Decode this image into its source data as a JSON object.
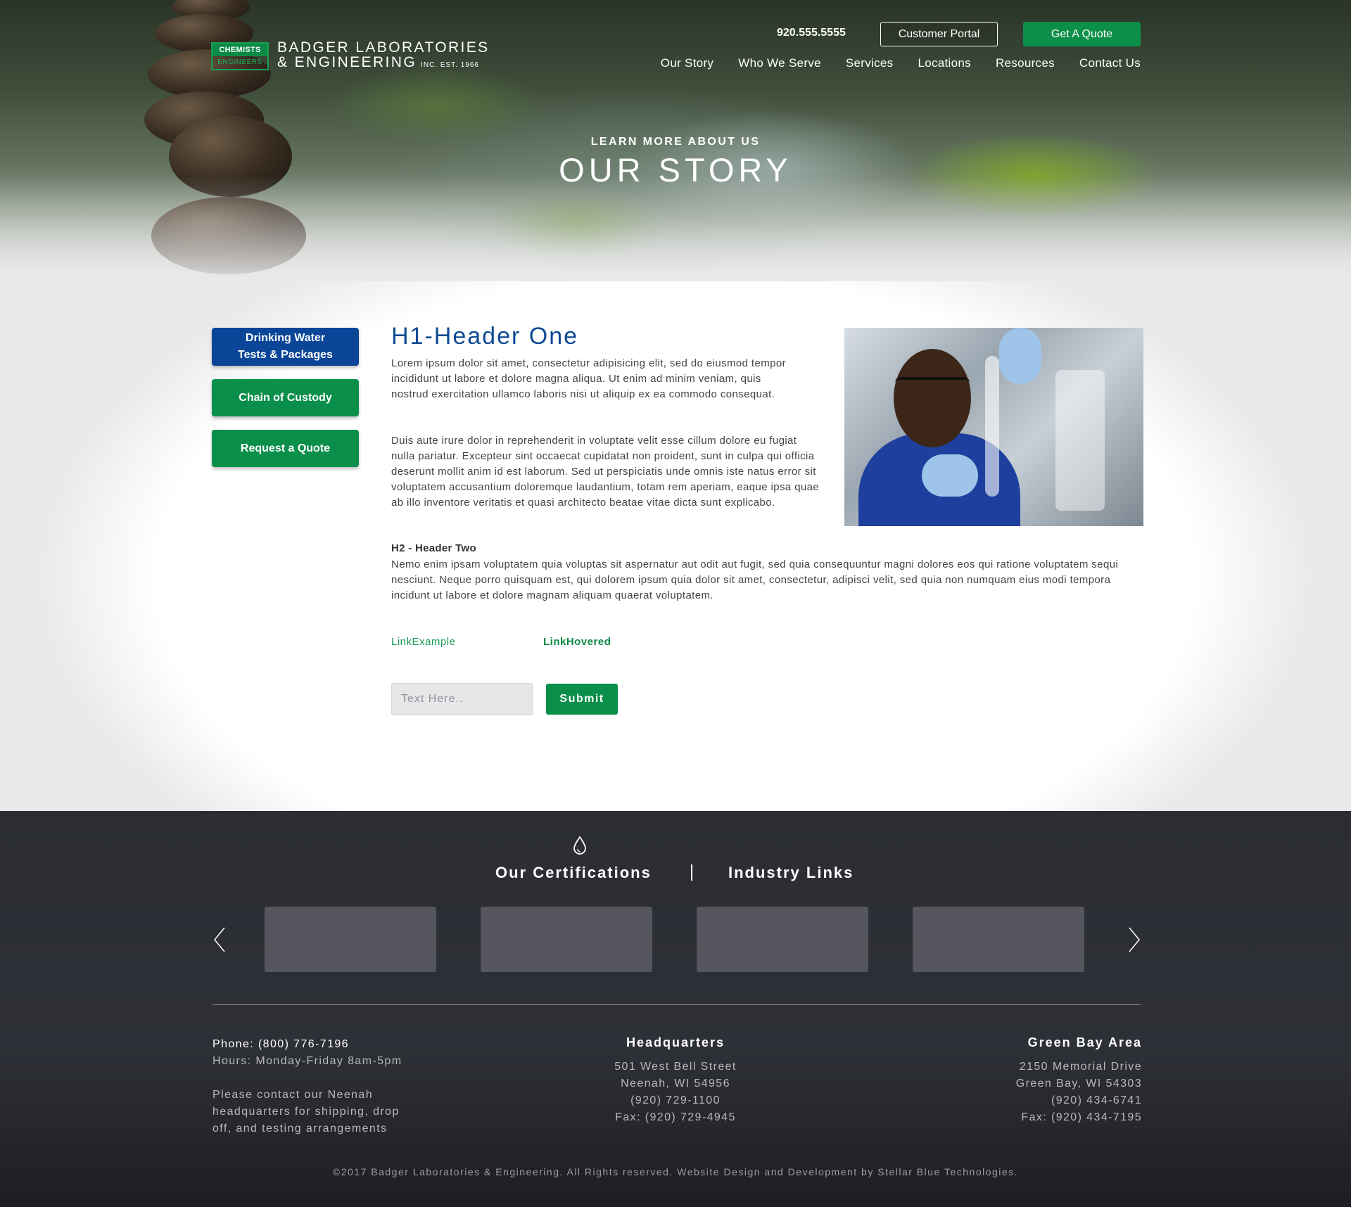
{
  "header": {
    "logo": {
      "badge_top": "CHEMISTS",
      "badge_bottom": "ENGINEERS",
      "line1": "BADGER LABORATORIES",
      "line2": "& ENGINEERING",
      "suffix": "INC.  EST. 1966"
    },
    "phone": "920.555.5555",
    "portal_label": "Customer Portal",
    "quote_label": "Get A Quote",
    "nav": [
      "Our Story",
      "Who We Serve",
      "Services",
      "Locations",
      "Resources",
      "Contact Us"
    ]
  },
  "hero": {
    "eyebrow": "LEARN MORE ABOUT US",
    "title": "OUR STORY"
  },
  "sidebar": {
    "buttons": [
      "Drinking Water Tests & Packages",
      "Chain of Custody",
      "Request a Quote"
    ]
  },
  "content": {
    "h1": "H1-Header One",
    "p1": "Lorem ipsum dolor sit amet, consectetur adipisicing elit, sed do eiusmod tempor incididunt ut labore et dolore magna aliqua. Ut enim ad minim veniam, quis nostrud exercitation ullamco laboris nisi ut aliquip ex ea commodo consequat.",
    "p2": "Duis aute irure dolor in reprehenderit in voluptate velit esse cillum dolore eu fugiat nulla pariatur. Excepteur sint occaecat cupidatat non proident, sunt in culpa qui officia deserunt mollit anim id est laborum. Sed ut perspiciatis unde omnis iste natus error sit voluptatem accusantium doloremque laudantium, totam rem aperiam, eaque ipsa quae ab illo inventore veritatis et quasi architecto beatae vitae dicta sunt explicabo.",
    "h2": "H2 - Header Two",
    "p3": "Nemo enim ipsam voluptatem quia voluptas sit aspernatur aut odit aut fugit, sed quia consequuntur magni dolores eos qui ratione voluptatem sequi nesciunt. Neque porro quisquam est, qui dolorem ipsum quia dolor sit amet, consectetur, adipisci velit, sed quia non numquam eius modi tempora incidunt ut labore et dolore magnam aliquam quaerat voluptatem.",
    "link_example": "LinkExample",
    "link_hovered": "LinkHovered",
    "input_placeholder": "Text Here..",
    "submit_label": "Submit"
  },
  "footer": {
    "tab_certifications": "Our Certifications",
    "tab_industry_links": "Industry Links",
    "left": {
      "phone": "Phone: (800) 776-7196",
      "hours": "Hours: Monday-Friday 8am-5pm",
      "note_1": "Please contact our Neenah",
      "note_2": "headquarters for shipping, drop",
      "note_3": "off, and testing arrangements"
    },
    "hq": {
      "title": "Headquarters",
      "lines": [
        "501 West Bell Street",
        "Neenah, WI 54956",
        "(920) 729-1100",
        "Fax: (920) 729-4945"
      ]
    },
    "greenbay": {
      "title": "Green Bay Area",
      "lines": [
        "2150 Memorial Drive",
        "Green Bay, WI 54303",
        "(920) 434-6741",
        "Fax: (920) 434-7195"
      ]
    },
    "copyright": "©2017 Badger Laboratories & Engineering. All Rights reserved. Website Design and Development by Stellar Blue Technologies."
  },
  "colors": {
    "brand_green": "#0a8f4a",
    "brand_blue": "#0a4597",
    "heading_blue": "#0d4a93",
    "footer_bg": "#2e3037"
  },
  "icons": {
    "drop": "water-drop-icon",
    "prev": "chevron-left-icon",
    "next": "chevron-right-icon"
  }
}
